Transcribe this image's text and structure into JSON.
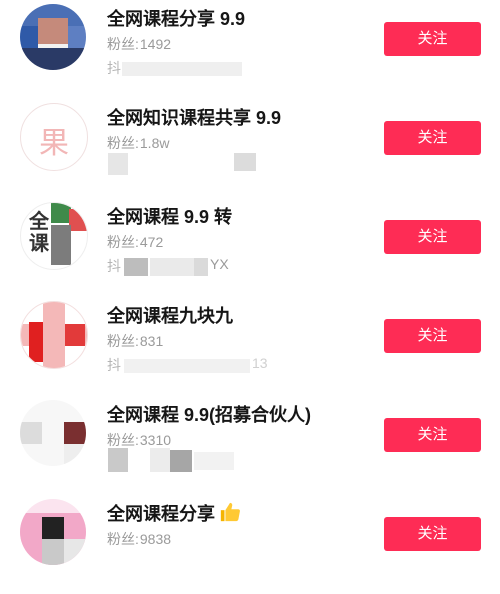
{
  "accounts": [
    {
      "name": "全网课程分享 9.9",
      "fans_label": "粉丝:",
      "fans": "1492",
      "sub": "抖",
      "follow_label": "关注"
    },
    {
      "name": "全网知识课程共享 9.9",
      "fans_label": "粉丝:",
      "fans": "1.8w",
      "sub": "",
      "follow_label": "关注",
      "avatar_text": "果"
    },
    {
      "name": "全网课程 9.9 转",
      "fans_label": "粉丝:",
      "fans": "472",
      "sub": "抖",
      "sub_tail": "YX",
      "follow_label": "关注",
      "avatar_text": "全课"
    },
    {
      "name": "全网课程九块九",
      "fans_label": "粉丝:",
      "fans": "831",
      "sub": "抖",
      "sub_tail": "13",
      "follow_label": "关注"
    },
    {
      "name": "全网课程 9.9(招募合伙人)",
      "fans_label": "粉丝:",
      "fans": "3310",
      "sub": "",
      "follow_label": "关注"
    },
    {
      "name": "全网课程分享",
      "fans_label": "粉丝:",
      "fans": "9838",
      "sub": "",
      "follow_label": "关注",
      "emoji_icon": "thumbs-up-icon"
    }
  ],
  "colors": {
    "follow_button": "#fe2c55",
    "name_text": "#161616",
    "meta_text": "#9a9a9a"
  }
}
